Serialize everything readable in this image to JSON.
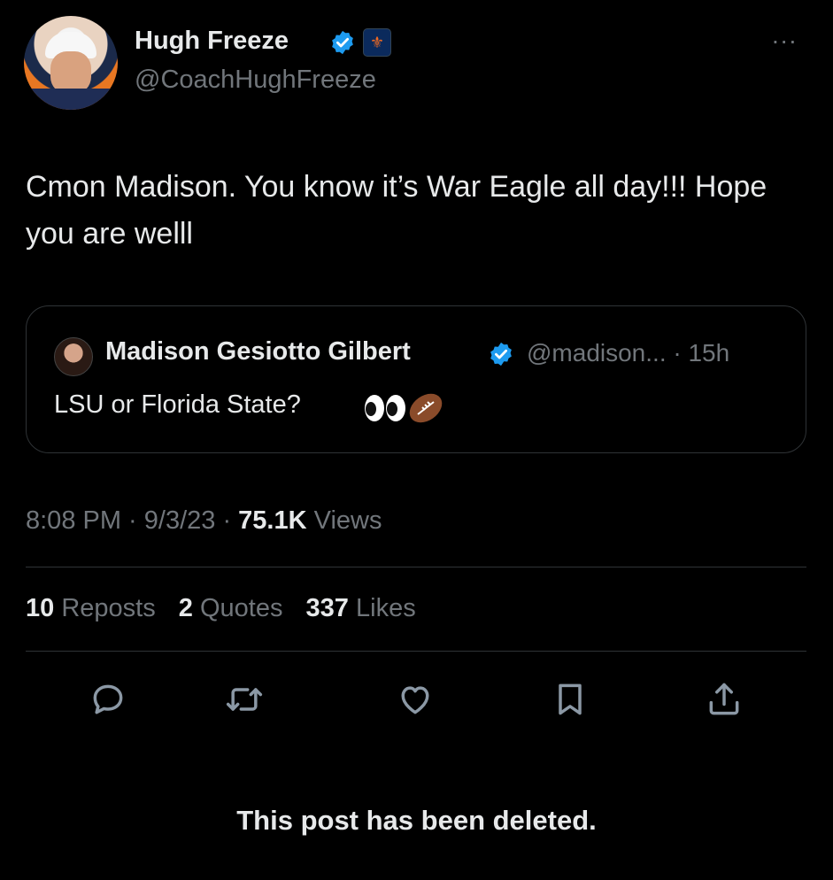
{
  "author": {
    "name": "Hugh Freeze",
    "handle": "@CoachHughFreeze",
    "affiliate_badge_icon": "auburn-badge-icon"
  },
  "tweet": {
    "text": "Cmon Madison. You know it’s War Eagle all day!!! Hope you are welll",
    "timestamp": "8:08 PM · 9/3/23 · ",
    "views_count": "75.1K",
    "views_label": " Views"
  },
  "quote": {
    "name": "Madison Gesiotto Gilbert",
    "handle_time": "@madison... · 15h",
    "text": "LSU or Florida State?"
  },
  "stats": {
    "reposts_count": "10",
    "reposts_label": "Reposts",
    "quotes_count": "2",
    "quotes_label": "Quotes",
    "likes_count": "337",
    "likes_label": "Likes"
  },
  "actions": [
    "reply-icon",
    "repost-icon",
    "like-icon",
    "bookmark-icon",
    "share-icon"
  ],
  "more_label": "...",
  "deleted_notice": "This post has been deleted.",
  "colors": {
    "background": "#000000",
    "primary_text": "#e7e9ea",
    "secondary_text": "#71767b",
    "verified_blue": "#1d9bf0",
    "border": "#2f3336"
  }
}
